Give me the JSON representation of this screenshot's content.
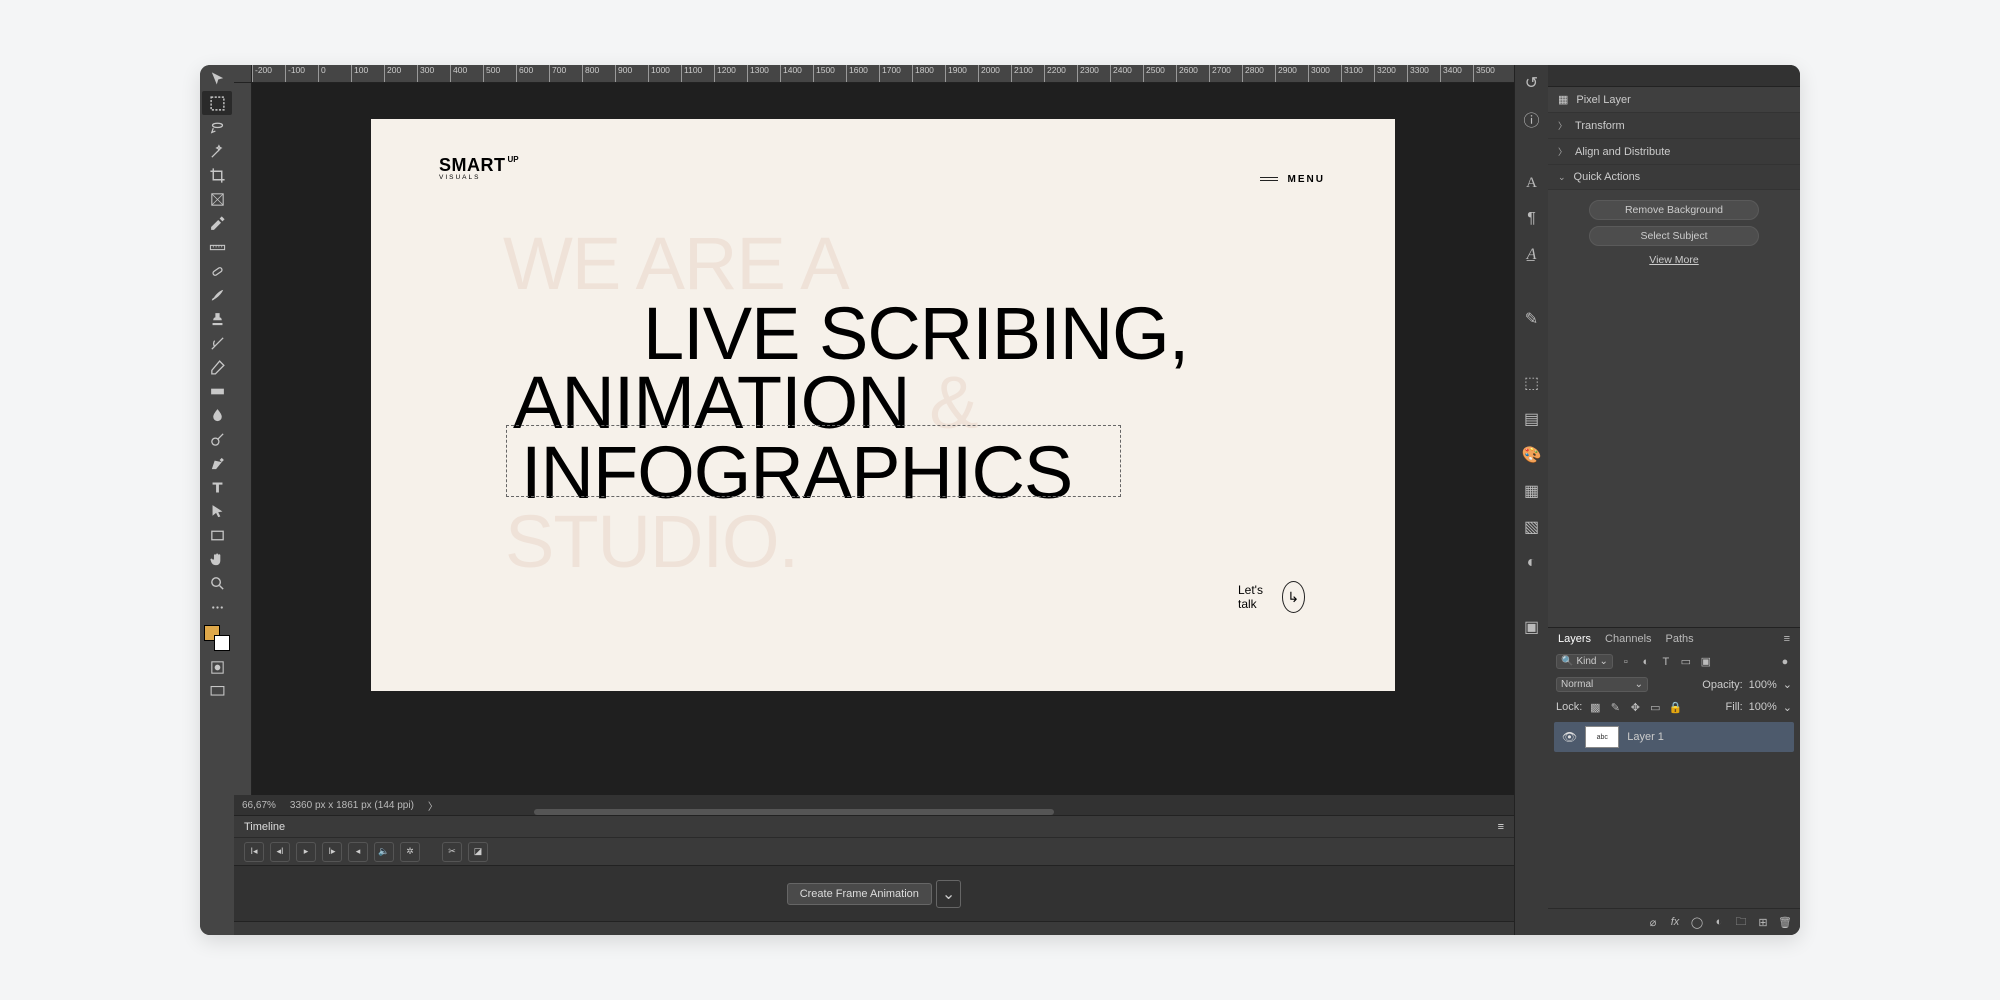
{
  "ruler": [
    "-200",
    "-100",
    "0",
    "100",
    "200",
    "300",
    "400",
    "500",
    "600",
    "700",
    "800",
    "900",
    "1000",
    "1100",
    "1200",
    "1300",
    "1400",
    "1500",
    "1600",
    "1700",
    "1800",
    "1900",
    "2000",
    "2100",
    "2200",
    "2300",
    "2400",
    "2500",
    "2600",
    "2700",
    "2800",
    "2900",
    "3000",
    "3100",
    "3200",
    "3300",
    "3400",
    "3500"
  ],
  "artboard": {
    "logo": {
      "main": "SMART",
      "sup": "UP",
      "sub": "VISUALS"
    },
    "menu": "MENU",
    "hero": {
      "l1": "WE ARE A",
      "l2": "LIVE SCRIBING,",
      "l3a": "ANIMATION ",
      "l3b": "&",
      "l4": "INFOGRAPHICS",
      "l5": "STUDIO."
    },
    "cta": {
      "label": "Let's talk",
      "arrow": "↳"
    }
  },
  "status": {
    "zoom": "66,67%",
    "dims": "3360 px x 1861 px (144 ppi)",
    "chev": "〉"
  },
  "timeline": {
    "title": "Timeline",
    "create": "Create Frame Animation"
  },
  "props": {
    "pixel": "Pixel Layer",
    "sections": [
      "Transform",
      "Align and Distribute",
      "Quick Actions"
    ],
    "actions": [
      "Remove Background",
      "Select Subject"
    ],
    "more": "View More"
  },
  "layers": {
    "tabs": [
      "Layers",
      "Channels",
      "Paths"
    ],
    "kind": "Kind",
    "blend": "Normal",
    "opacity_lbl": "Opacity:",
    "opacity_val": "100%",
    "lock_lbl": "Lock:",
    "fill_lbl": "Fill:",
    "fill_val": "100%",
    "item": "Layer 1"
  }
}
